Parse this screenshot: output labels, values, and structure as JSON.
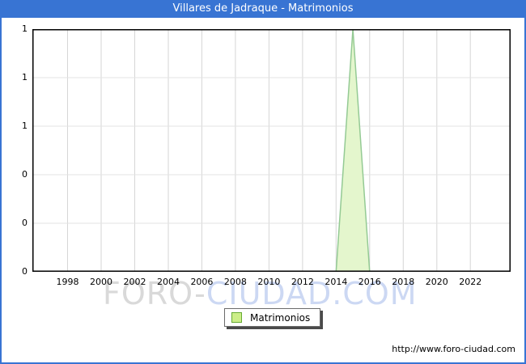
{
  "title_bar": {
    "text": "Villares de Jadraque - Matrimonios",
    "bg_color": "#3874d3",
    "text_color": "#ffffff"
  },
  "frame_color": "#3874d3",
  "watermark": {
    "part1": "FORO-",
    "part2": "CIUDAD.COM",
    "color1": "#d9d9d9",
    "color2": "#ccd8f3"
  },
  "legend": {
    "label": "Matrimonios",
    "swatch_fill": "#ccee88",
    "swatch_border": "#66aa33"
  },
  "footer": {
    "url": "http://www.foro-ciudad.com"
  },
  "chart_data": {
    "type": "area",
    "title": "Villares de Jadraque - Matrimonios",
    "xlabel": "",
    "ylabel": "",
    "grid": true,
    "legend_position": "bottom-center",
    "xlim": [
      1995.9,
      2024.4
    ],
    "ylim": [
      0,
      1
    ],
    "x_ticks": [
      1998,
      2000,
      2002,
      2004,
      2006,
      2008,
      2010,
      2012,
      2014,
      2016,
      2018,
      2020,
      2022
    ],
    "y_ticks": [
      {
        "value": 0.0,
        "label": "0"
      },
      {
        "value": 0.2,
        "label": "0"
      },
      {
        "value": 0.4,
        "label": "0"
      },
      {
        "value": 0.6,
        "label": "1"
      },
      {
        "value": 0.8,
        "label": "1"
      },
      {
        "value": 1.0,
        "label": "1"
      }
    ],
    "series": [
      {
        "name": "Matrimonios",
        "x": [
          1996,
          1997,
          1998,
          1999,
          2000,
          2001,
          2002,
          2003,
          2004,
          2005,
          2006,
          2007,
          2008,
          2009,
          2010,
          2011,
          2012,
          2013,
          2014,
          2015,
          2016,
          2017,
          2018,
          2019,
          2020,
          2021,
          2022,
          2023,
          2024
        ],
        "y": [
          0,
          0,
          0,
          0,
          0,
          0,
          0,
          0,
          0,
          0,
          0,
          0,
          0,
          0,
          0,
          0,
          0,
          0,
          0,
          1,
          0,
          0,
          0,
          0,
          0,
          0,
          0,
          0,
          0
        ]
      }
    ],
    "fill_color": "#e4f6cd",
    "line_color": "#94ca94",
    "vgrid_color": "#d6d6d6",
    "hgrid_color": "#e3e3e3",
    "border_color": "#000000"
  }
}
